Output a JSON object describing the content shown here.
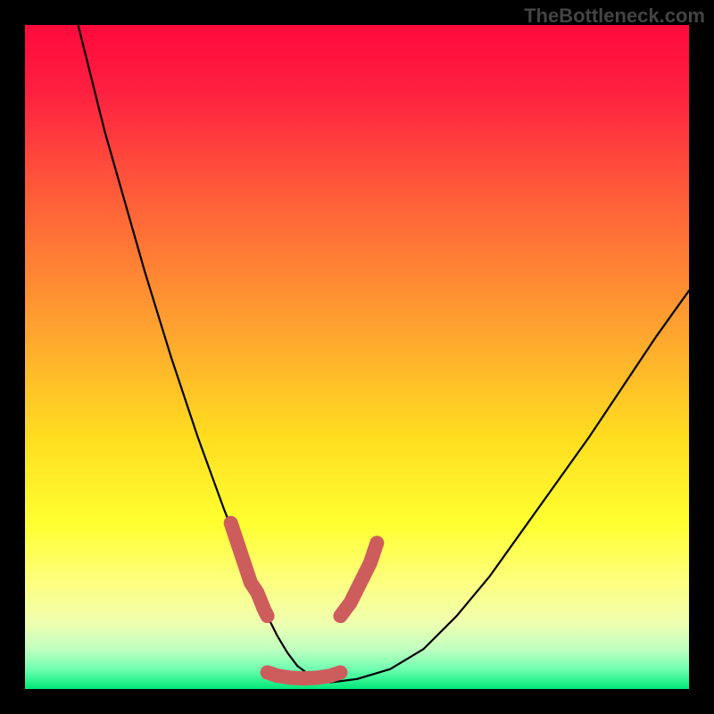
{
  "watermark": "TheBottleneck.com",
  "chart_data": {
    "type": "line",
    "title": "",
    "xlabel": "",
    "ylabel": "",
    "xlim": [
      0,
      100
    ],
    "ylim": [
      0,
      100
    ],
    "grid": false,
    "series": [
      {
        "name": "bottleneck-curve",
        "color": "#000000",
        "x": [
          8,
          10,
          12,
          14,
          16,
          18,
          20,
          22,
          24,
          26,
          28,
          30,
          32,
          33.5,
          35,
          36.5,
          38,
          39.5,
          41,
          43,
          46,
          50,
          55,
          60,
          65,
          70,
          75,
          80,
          85,
          90,
          95,
          100
        ],
        "y": [
          100,
          92,
          84,
          77,
          70,
          63,
          56.5,
          50,
          44,
          38,
          32.5,
          27,
          22,
          18,
          14.5,
          11,
          8,
          5.5,
          3.5,
          2,
          1,
          1.5,
          3,
          6,
          11,
          17,
          24,
          31,
          38,
          45.5,
          53,
          60
        ]
      },
      {
        "name": "highlight-left-descent",
        "color": "#cd5c5c",
        "x": [
          31,
          32,
          33,
          34,
          35,
          36,
          36.5
        ],
        "y": [
          25,
          22,
          19,
          16,
          14.5,
          12,
          11
        ]
      },
      {
        "name": "highlight-trough",
        "color": "#cd5c5c",
        "x": [
          36.5,
          38,
          40,
          42,
          44,
          46,
          47.5
        ],
        "y": [
          2.5,
          2,
          1.7,
          1.6,
          1.7,
          2,
          2.5
        ]
      },
      {
        "name": "highlight-right-ascent",
        "color": "#cd5c5c",
        "x": [
          47.5,
          49,
          50.5,
          52,
          53
        ],
        "y": [
          11,
          13,
          16,
          19,
          22
        ]
      }
    ],
    "background_gradient_stops": [
      {
        "pos": 0.0,
        "color": "#ff0a3c"
      },
      {
        "pos": 0.1,
        "color": "#ff2040"
      },
      {
        "pos": 0.25,
        "color": "#ff5a3a"
      },
      {
        "pos": 0.45,
        "color": "#ffa030"
      },
      {
        "pos": 0.62,
        "color": "#ffdd20"
      },
      {
        "pos": 0.75,
        "color": "#ffff30"
      },
      {
        "pos": 0.84,
        "color": "#fdff80"
      },
      {
        "pos": 0.9,
        "color": "#efffb0"
      },
      {
        "pos": 0.94,
        "color": "#c0ffc0"
      },
      {
        "pos": 0.97,
        "color": "#70ffb0"
      },
      {
        "pos": 1.0,
        "color": "#00e878"
      }
    ]
  }
}
